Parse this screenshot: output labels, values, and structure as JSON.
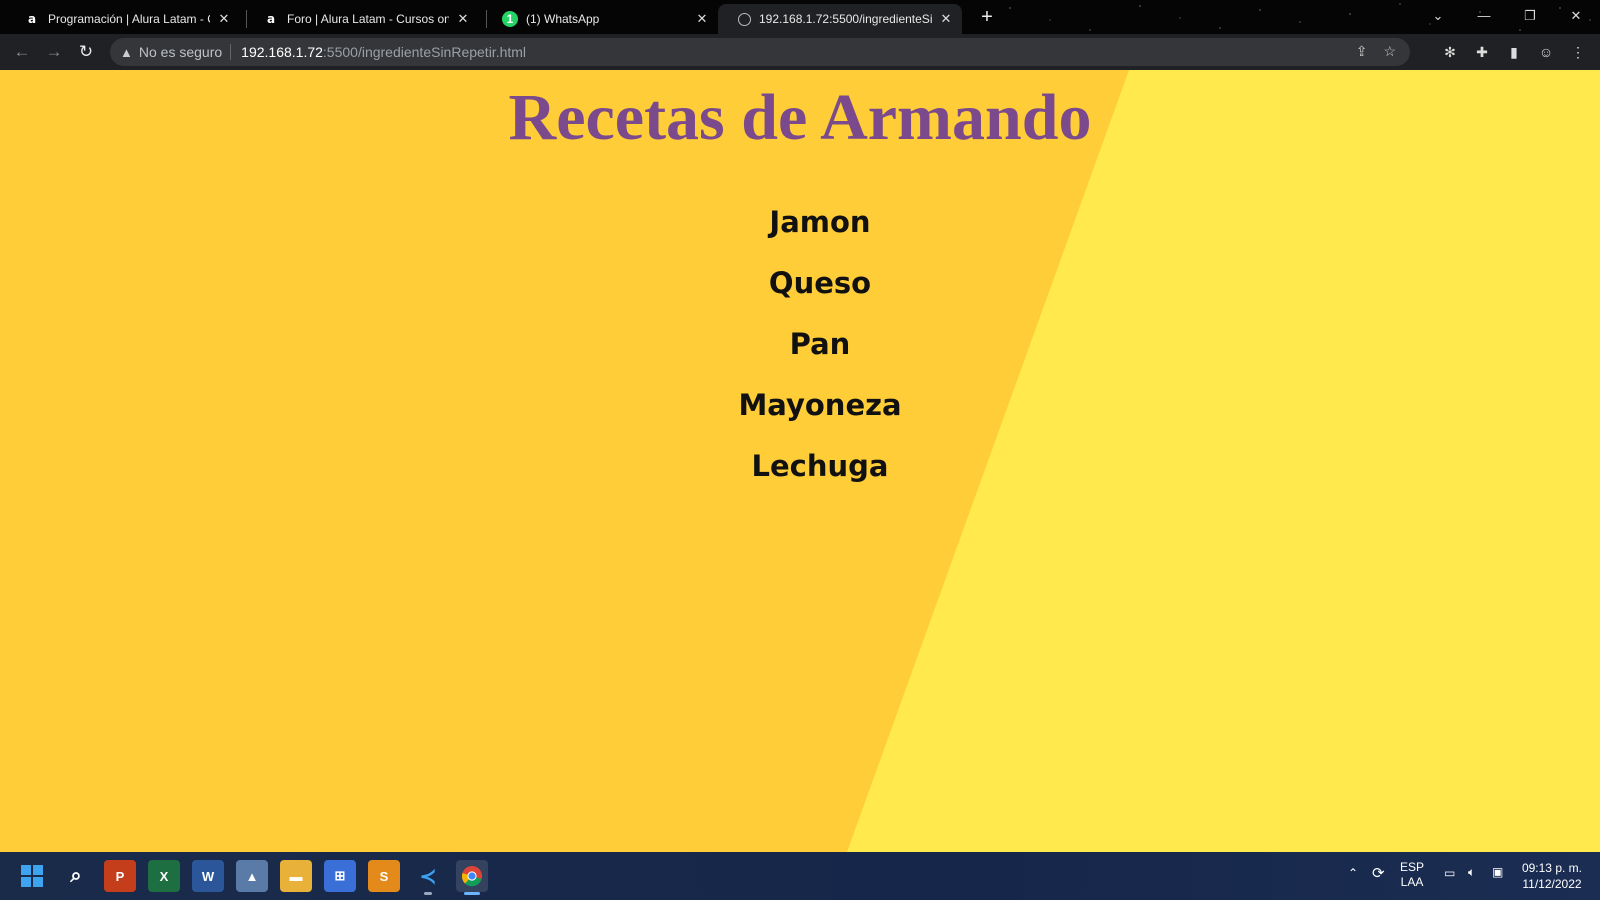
{
  "browser": {
    "tabs": [
      {
        "title": "Programación | Alura Latam - Cu",
        "icon": "alura-icon",
        "active": false
      },
      {
        "title": "Foro | Alura Latam - Cursos onlin",
        "icon": "alura-icon",
        "active": false
      },
      {
        "title": "(1) WhatsApp",
        "icon": "whatsapp-icon",
        "active": false
      },
      {
        "title": "192.168.1.72:5500/ingredienteSi",
        "icon": "globe-icon",
        "active": true
      }
    ],
    "security_label": "No es seguro",
    "url_host": "192.168.1.72",
    "url_rest": ":5500/ingredienteSinRepetir.html"
  },
  "page": {
    "heading": "Recetas de Armando",
    "ingredients": [
      "Jamon",
      "Queso",
      "Pan",
      "Mayoneza",
      "Lechuga"
    ]
  },
  "taskbar": {
    "language_top": "ESP",
    "language_bottom": "LAA",
    "time": "09:13 p. m.",
    "date": "11/12/2022"
  },
  "colors": {
    "page_left": "#fecd38",
    "page_right": "#ffe94c",
    "heading": "#7b4a8c"
  }
}
